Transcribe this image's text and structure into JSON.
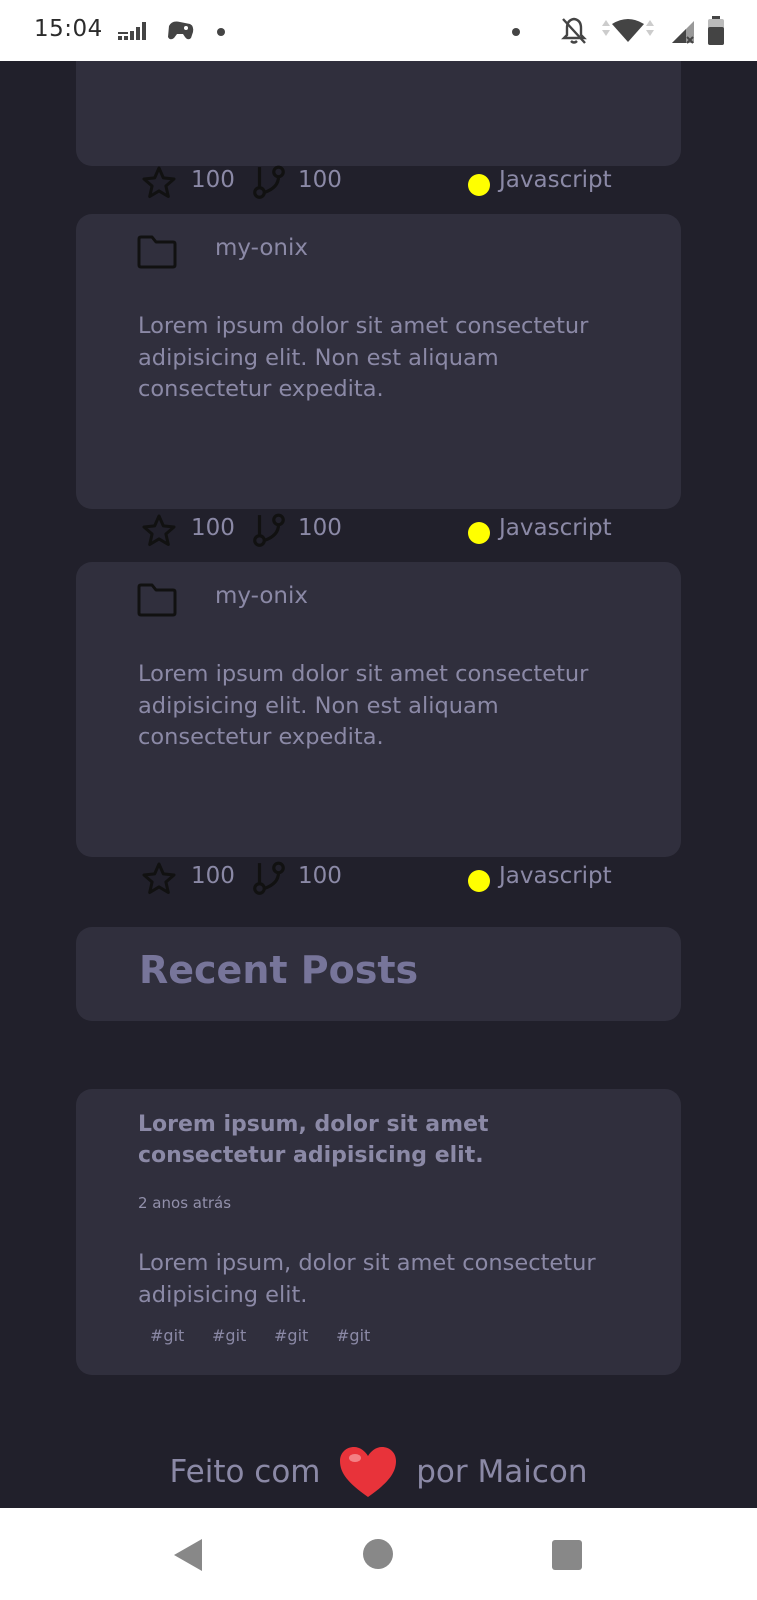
{
  "status_bar": {
    "time": "15:04",
    "icons": [
      "signal-bars-icon",
      "game-controller-icon",
      "dot-icon",
      "dot-icon",
      "notifications-off-icon",
      "wifi-icon",
      "cell-signal-icon",
      "battery-icon"
    ]
  },
  "repos": [
    {
      "stars": "100",
      "forks": "100",
      "language": "Javascript"
    },
    {
      "name": "my-onix",
      "description": "Lorem ipsum dolor sit amet consectetur adipisicing elit. Non est aliquam consectetur expedita.",
      "stars": "100",
      "forks": "100",
      "language": "Javascript"
    },
    {
      "name": "my-onix",
      "description": "Lorem ipsum dolor sit amet consectetur adipisicing elit. Non est aliquam consectetur expedita.",
      "stars": "100",
      "forks": "100",
      "language": "Javascript"
    }
  ],
  "language_color": "#ffff00",
  "recent_posts": {
    "title": "Recent Posts",
    "posts": [
      {
        "title": "Lorem ipsum, dolor sit amet consectetur adipisicing elit.",
        "date": "2 anos atrás",
        "body": "Lorem ipsum, dolor sit amet consectetur adipisicing elit.",
        "tags": [
          "#git",
          "#git",
          "#git",
          "#git"
        ]
      }
    ]
  },
  "footer": {
    "before": "Feito com",
    "after": "por Maicon"
  },
  "nav": {
    "back": "back-icon",
    "home": "home-icon",
    "recents": "recents-icon"
  }
}
